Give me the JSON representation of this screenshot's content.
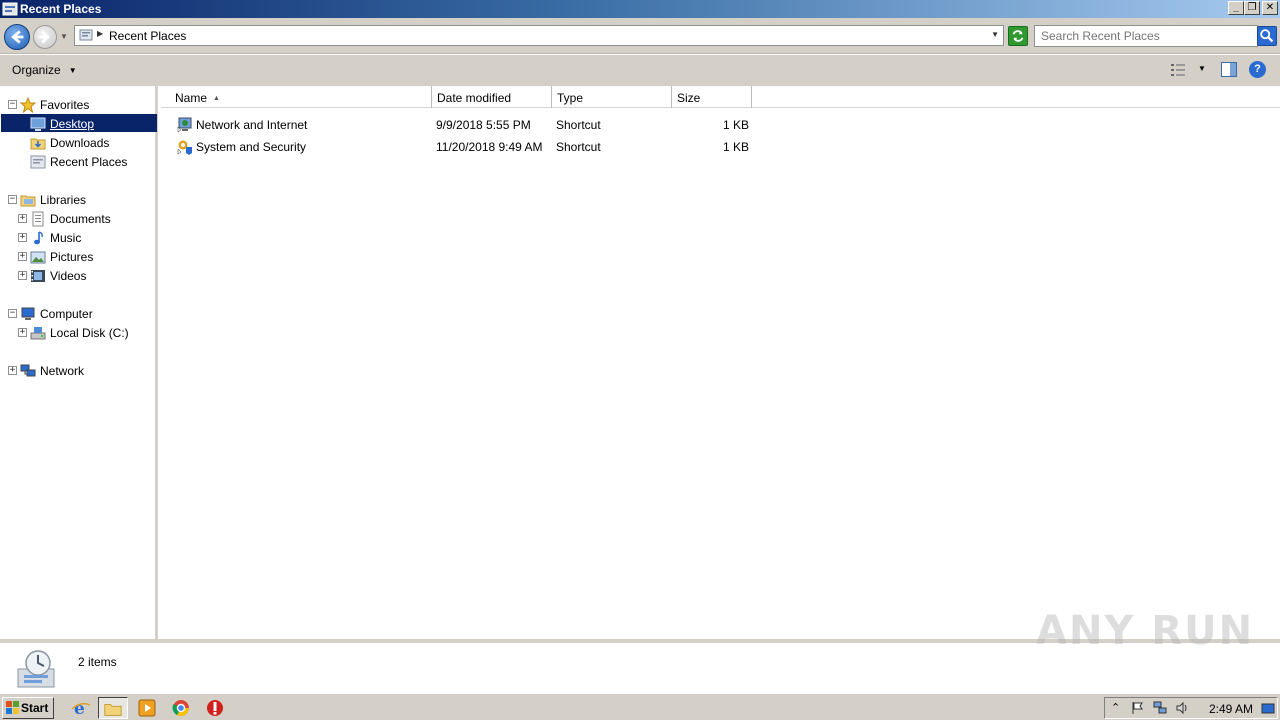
{
  "window": {
    "title": "Recent Places"
  },
  "address": {
    "breadcrumb": "Recent Places",
    "search_placeholder": "Search Recent Places"
  },
  "toolbar": {
    "organize_label": "Organize"
  },
  "nav": {
    "favorites": {
      "label": "Favorites",
      "items": [
        "Desktop",
        "Downloads",
        "Recent Places"
      ]
    },
    "libraries": {
      "label": "Libraries",
      "items": [
        "Documents",
        "Music",
        "Pictures",
        "Videos"
      ]
    },
    "computer": {
      "label": "Computer",
      "items": [
        "Local Disk (C:)"
      ]
    },
    "network": {
      "label": "Network"
    }
  },
  "columns": {
    "name": "Name",
    "date": "Date modified",
    "type": "Type",
    "size": "Size"
  },
  "files": [
    {
      "name": "Network and Internet",
      "date": "9/9/2018 5:55 PM",
      "type": "Shortcut",
      "size": "1 KB"
    },
    {
      "name": "System and Security",
      "date": "11/20/2018 9:49 AM",
      "type": "Shortcut",
      "size": "1 KB"
    }
  ],
  "status": {
    "item_count": "2 items"
  },
  "watermark": "ANY RUN",
  "taskbar": {
    "start_label": "Start",
    "clock": "2:49 AM"
  },
  "colors": {
    "selection": "#0a246a",
    "titlebar_start": "#0a246a",
    "chrome": "#d4d0c8"
  }
}
